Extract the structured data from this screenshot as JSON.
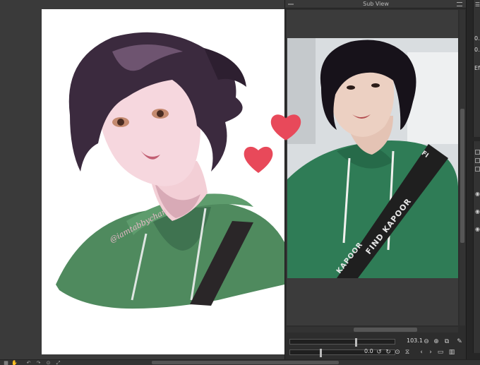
{
  "subview": {
    "title": "Sub View",
    "zoom_value": "103.1",
    "rotation_value": "0.0"
  },
  "canvas": {
    "watermark": "@iamtabbychan"
  },
  "photo": {
    "strap_text": "FIND KAPOOR",
    "strap_text_lower": "KAPOOR",
    "hoodie_text": "FI"
  },
  "dock": {
    "text_1": "0.",
    "text_2": "0.",
    "text_3": "Ef"
  },
  "colors": {
    "hoodie_green": "#4f8a5e",
    "heart_red": "#e8495a",
    "hair_purple": "#3b2a3e"
  }
}
